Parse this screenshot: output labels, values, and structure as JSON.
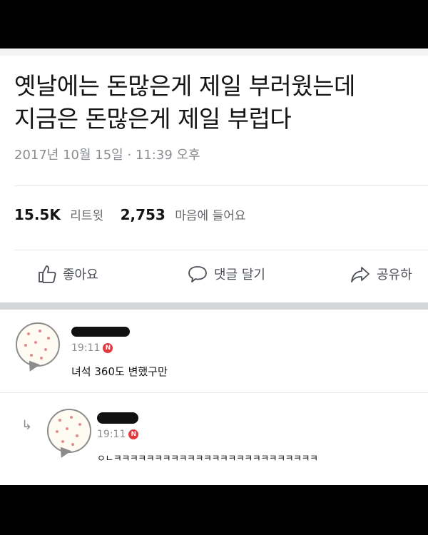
{
  "tweet": {
    "line1": "옛날에는 돈많은게 제일 부러웠는데",
    "line2": "지금은 돈많은게 제일 부럽다",
    "timestamp": "2017년 10월 15일 · 11:39 오후",
    "retweet_count": "15.5K",
    "retweet_label": "리트윗",
    "like_count": "2,753",
    "like_label": "마음에 들어요"
  },
  "actions": {
    "like": "좋아요",
    "comment": "댓글 달기",
    "share": "공유하"
  },
  "comments": [
    {
      "time": "19:11",
      "badge": "N",
      "text": "녀석 360도 변했구만"
    },
    {
      "time": "19:11",
      "badge": "N",
      "text": "ㅇㄴㅋㅋㅋㅋㅋㅋㅋㅋㅋㅋㅋㅋㅋㅋㅋㅋㅋㅋㅋㅋㅋㅋㅋㅋㅋ"
    }
  ],
  "icons": [
    "thumbs-up-icon",
    "speech-bubble-icon",
    "share-arrow-icon",
    "reply-arrow-icon"
  ]
}
